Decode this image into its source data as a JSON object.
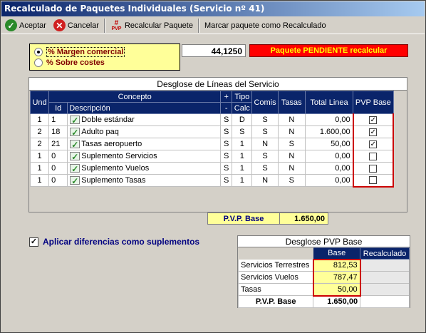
{
  "window": {
    "title": "Recalculado de Paquetes Individuales (Servicio nº 41)"
  },
  "toolbar": {
    "accept": "Aceptar",
    "cancel": "Cancelar",
    "recalc": "Recalcular Paquete",
    "recalc_icon_text": "PVP",
    "mark": "Marcar paquete como Recalculado"
  },
  "mode": {
    "option_margin": "% Margen comercial",
    "option_costs": "% Sobre costes",
    "selected": "% Margen comercial",
    "value": "44,1250"
  },
  "status": {
    "pending": "Paquete PENDIENTE recalcular",
    "color": "#ff0000"
  },
  "lines_panel": {
    "title": "Desglose de Líneas del Servicio",
    "headers": {
      "und": "Und",
      "concepto": "Concepto",
      "id": "Id",
      "descripcion": "Descripción",
      "plus": "+",
      "minus": "-",
      "tipo1": "Tipo",
      "tipo2": "Calc",
      "comis": "Comis",
      "tasas": "Tasas",
      "total": "Total Linea",
      "pvp": "PVP Base"
    },
    "rows": [
      {
        "und": "1",
        "id": "1",
        "desc": "Doble estándar",
        "sign": "S",
        "tipo": "D",
        "comis": "S",
        "tasas": "N",
        "total": "0,00",
        "pvp": true
      },
      {
        "und": "2",
        "id": "18",
        "desc": "Adulto paq",
        "sign": "S",
        "tipo": "S",
        "comis": "S",
        "tasas": "N",
        "total": "1.600,00",
        "pvp": true
      },
      {
        "und": "2",
        "id": "21",
        "desc": "Tasas aeropuerto",
        "sign": "S",
        "tipo": "1",
        "comis": "N",
        "tasas": "S",
        "total": "50,00",
        "pvp": true
      },
      {
        "und": "1",
        "id": "0",
        "desc": "Suplemento Servicios",
        "sign": "S",
        "tipo": "1",
        "comis": "S",
        "tasas": "N",
        "total": "0,00",
        "pvp": false
      },
      {
        "und": "1",
        "id": "0",
        "desc": "Suplemento Vuelos",
        "sign": "S",
        "tipo": "1",
        "comis": "S",
        "tasas": "N",
        "total": "0,00",
        "pvp": false
      },
      {
        "und": "1",
        "id": "0",
        "desc": "Suplemento Tasas",
        "sign": "S",
        "tipo": "1",
        "comis": "N",
        "tasas": "S",
        "total": "0,00",
        "pvp": false
      }
    ],
    "total_label": "P.V.P. Base",
    "total_value": "1.650,00"
  },
  "apply": {
    "label": "Aplicar diferencias como suplementos",
    "checked": true
  },
  "pvp_panel": {
    "title": "Desglose PVP Base",
    "col_base": "Base",
    "col_recalc": "Recalculado",
    "rows": [
      {
        "label": "Servicios Terrestres",
        "base": "812,53",
        "recalc": ""
      },
      {
        "label": "Servicios Vuelos",
        "base": "787,47",
        "recalc": ""
      },
      {
        "label": "Tasas",
        "base": "50,00",
        "recalc": ""
      }
    ],
    "total_label": "P.V.P. Base",
    "total_value": "1.650,00"
  }
}
